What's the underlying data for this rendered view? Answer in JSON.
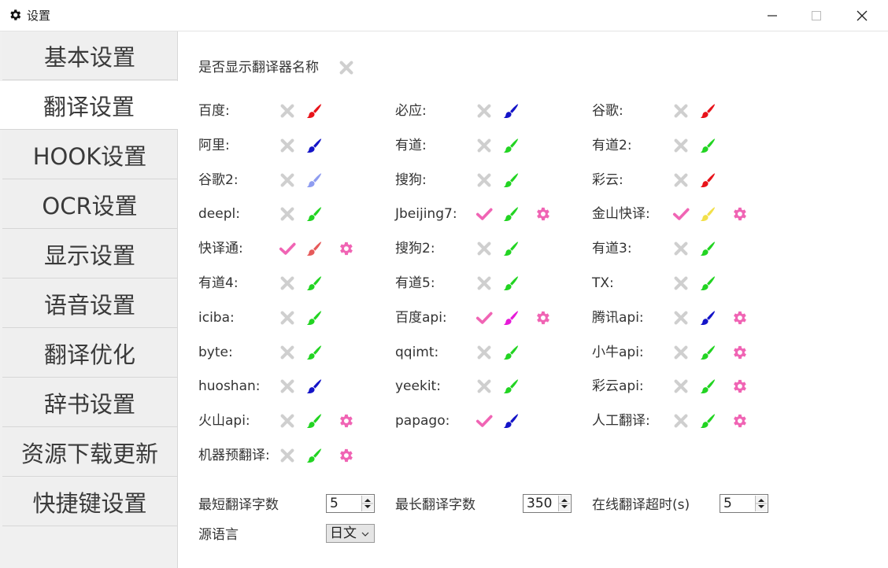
{
  "window": {
    "title": "设置",
    "icon": "gear-icon"
  },
  "sidebar": {
    "items": [
      {
        "label": "基本设置"
      },
      {
        "label": "翻译设置"
      },
      {
        "label": "HOOK设置"
      },
      {
        "label": "OCR设置"
      },
      {
        "label": "显示设置"
      },
      {
        "label": "语音设置"
      },
      {
        "label": "翻译优化"
      },
      {
        "label": "辞书设置"
      },
      {
        "label": "资源下载更新"
      },
      {
        "label": "快捷键设置"
      }
    ],
    "active_index": 1
  },
  "main": {
    "show_name_label": "是否显示翻译器名称",
    "show_name_enabled": false,
    "translators": [
      {
        "name": "百度:",
        "enabled": false,
        "color": "#e8131a",
        "settings": false
      },
      {
        "name": "必应:",
        "enabled": false,
        "color": "#1414c8",
        "settings": false
      },
      {
        "name": "谷歌:",
        "enabled": false,
        "color": "#e8131a",
        "settings": false
      },
      {
        "name": "阿里:",
        "enabled": false,
        "color": "#1414c8",
        "settings": false
      },
      {
        "name": "有道:",
        "enabled": false,
        "color": "#22d422",
        "settings": false
      },
      {
        "name": "有道2:",
        "enabled": false,
        "color": "#22d422",
        "settings": false
      },
      {
        "name": "谷歌2:",
        "enabled": false,
        "color": "#8e9cf0",
        "settings": false
      },
      {
        "name": "搜狗:",
        "enabled": false,
        "color": "#22d422",
        "settings": false
      },
      {
        "name": "彩云:",
        "enabled": false,
        "color": "#e8131a",
        "settings": false
      },
      {
        "name": "deepl:",
        "enabled": false,
        "color": "#22d422",
        "settings": false
      },
      {
        "name": "Jbeijing7:",
        "enabled": true,
        "color": "#22d422",
        "settings": true
      },
      {
        "name": "金山快译:",
        "enabled": true,
        "color": "#f2e04a",
        "settings": true
      },
      {
        "name": "快译通:",
        "enabled": true,
        "color": "#e65a5a",
        "settings": true
      },
      {
        "name": "搜狗2:",
        "enabled": false,
        "color": "#22d422",
        "settings": false
      },
      {
        "name": "有道3:",
        "enabled": false,
        "color": "#22d422",
        "settings": false
      },
      {
        "name": "有道4:",
        "enabled": false,
        "color": "#22d422",
        "settings": false
      },
      {
        "name": "有道5:",
        "enabled": false,
        "color": "#22d422",
        "settings": false
      },
      {
        "name": "TX:",
        "enabled": false,
        "color": "#22d422",
        "settings": false
      },
      {
        "name": "iciba:",
        "enabled": false,
        "color": "#22d422",
        "settings": false
      },
      {
        "name": "百度api:",
        "enabled": true,
        "color": "#e61ad8",
        "settings": true
      },
      {
        "name": "腾讯api:",
        "enabled": false,
        "color": "#1414c8",
        "settings": true
      },
      {
        "name": "byte:",
        "enabled": false,
        "color": "#22d422",
        "settings": false
      },
      {
        "name": "qqimt:",
        "enabled": false,
        "color": "#22d422",
        "settings": false
      },
      {
        "name": "小牛api:",
        "enabled": false,
        "color": "#22d422",
        "settings": true
      },
      {
        "name": "huoshan:",
        "enabled": false,
        "color": "#1414c8",
        "settings": false
      },
      {
        "name": "yeekit:",
        "enabled": false,
        "color": "#22d422",
        "settings": false
      },
      {
        "name": "彩云api:",
        "enabled": false,
        "color": "#22d422",
        "settings": true
      },
      {
        "name": "火山api:",
        "enabled": false,
        "color": "#22d422",
        "settings": true
      },
      {
        "name": "papago:",
        "enabled": true,
        "color": "#1414c8",
        "settings": false
      },
      {
        "name": "人工翻译:",
        "enabled": false,
        "color": "#22d422",
        "settings": true
      },
      {
        "name": "机器预翻译:",
        "enabled": false,
        "color": "#22d422",
        "settings": true
      }
    ],
    "min_chars": {
      "label": "最短翻译字数",
      "value": "5"
    },
    "max_chars": {
      "label": "最长翻译字数",
      "value": "350"
    },
    "timeout": {
      "label": "在线翻译超时(s)",
      "value": "5"
    },
    "source_lang": {
      "label": "源语言",
      "value": "日文"
    }
  },
  "colors": {
    "check_on": "#f064b4",
    "check_off": "#cfcfcf",
    "gear": "#f064b4"
  }
}
